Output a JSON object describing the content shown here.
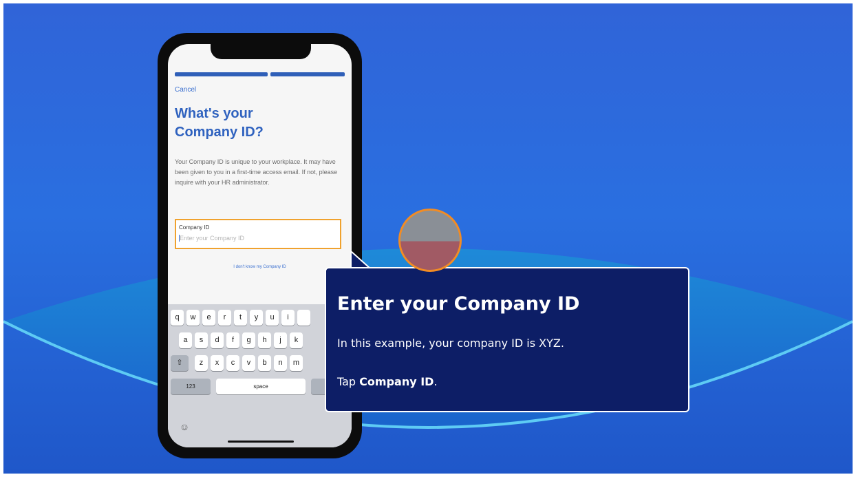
{
  "phone_app": {
    "cancel": "Cancel",
    "heading": "What's your Company ID?",
    "description": "Your Company ID is unique to your workplace. It may have been given to you in a first-time access email. If not, please inquire with your HR administrator.",
    "field_label": "Company ID",
    "field_placeholder": "Enter your Company ID",
    "field_value": "",
    "dont_know_link": "I don't know my Company ID",
    "progress_steps": 2,
    "accent_color": "#2f62bf",
    "field_border_color": "#f0a22e"
  },
  "keyboard": {
    "row1": [
      "q",
      "w",
      "e",
      "r",
      "t",
      "y",
      "u",
      "i"
    ],
    "row2": [
      "a",
      "s",
      "d",
      "f",
      "g",
      "h",
      "j",
      "k"
    ],
    "row3": [
      "z",
      "x",
      "c",
      "v",
      "b",
      "n",
      "m"
    ],
    "shift_icon": "shift-icon",
    "numbers_key": "123",
    "space_key": "space",
    "emoji_icon": "emoji-icon"
  },
  "tooltip": {
    "title": "Enter your Company ID",
    "body": "In this example, your company ID is XYZ.",
    "instruction_prefix": "Tap ",
    "instruction_bold": "Company ID",
    "instruction_suffix": ".",
    "background_color": "#0d1e66"
  },
  "hotspot": {
    "icon": "click-target-icon",
    "ring_color": "#f28c24"
  },
  "colors": {
    "background": "#2a6fe0",
    "arc_line": "#5ecbf4"
  }
}
